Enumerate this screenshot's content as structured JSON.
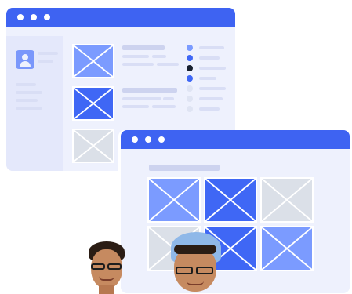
{
  "colors": {
    "titlebar": "#3e63f2",
    "window_bg": "#eef1fd",
    "sidebar_bg": "#e4e8fb",
    "placeholder_light_blue": "#7b9bff",
    "placeholder_blue": "#3f67f5",
    "placeholder_gray": "#dbe0e8",
    "text_line": "#d9def5"
  },
  "back_window": {
    "titlebar_dots": 3,
    "profile_icon": "user-icon",
    "image_tiles": [
      "light-blue",
      "blue",
      "gray"
    ],
    "list_bullets": [
      "#7b9bff",
      "#3f67f5",
      "#17202f",
      "#3f67f5",
      "#dfe4f3",
      "#dfe4f3",
      "#dfe4f3"
    ]
  },
  "front_window": {
    "titlebar_dots": 3,
    "grid_tiles": [
      "light-blue",
      "blue",
      "gray",
      "gray",
      "blue",
      "light-blue"
    ]
  },
  "avatars": [
    "person-with-glasses",
    "person-with-beanie-and-glasses"
  ]
}
